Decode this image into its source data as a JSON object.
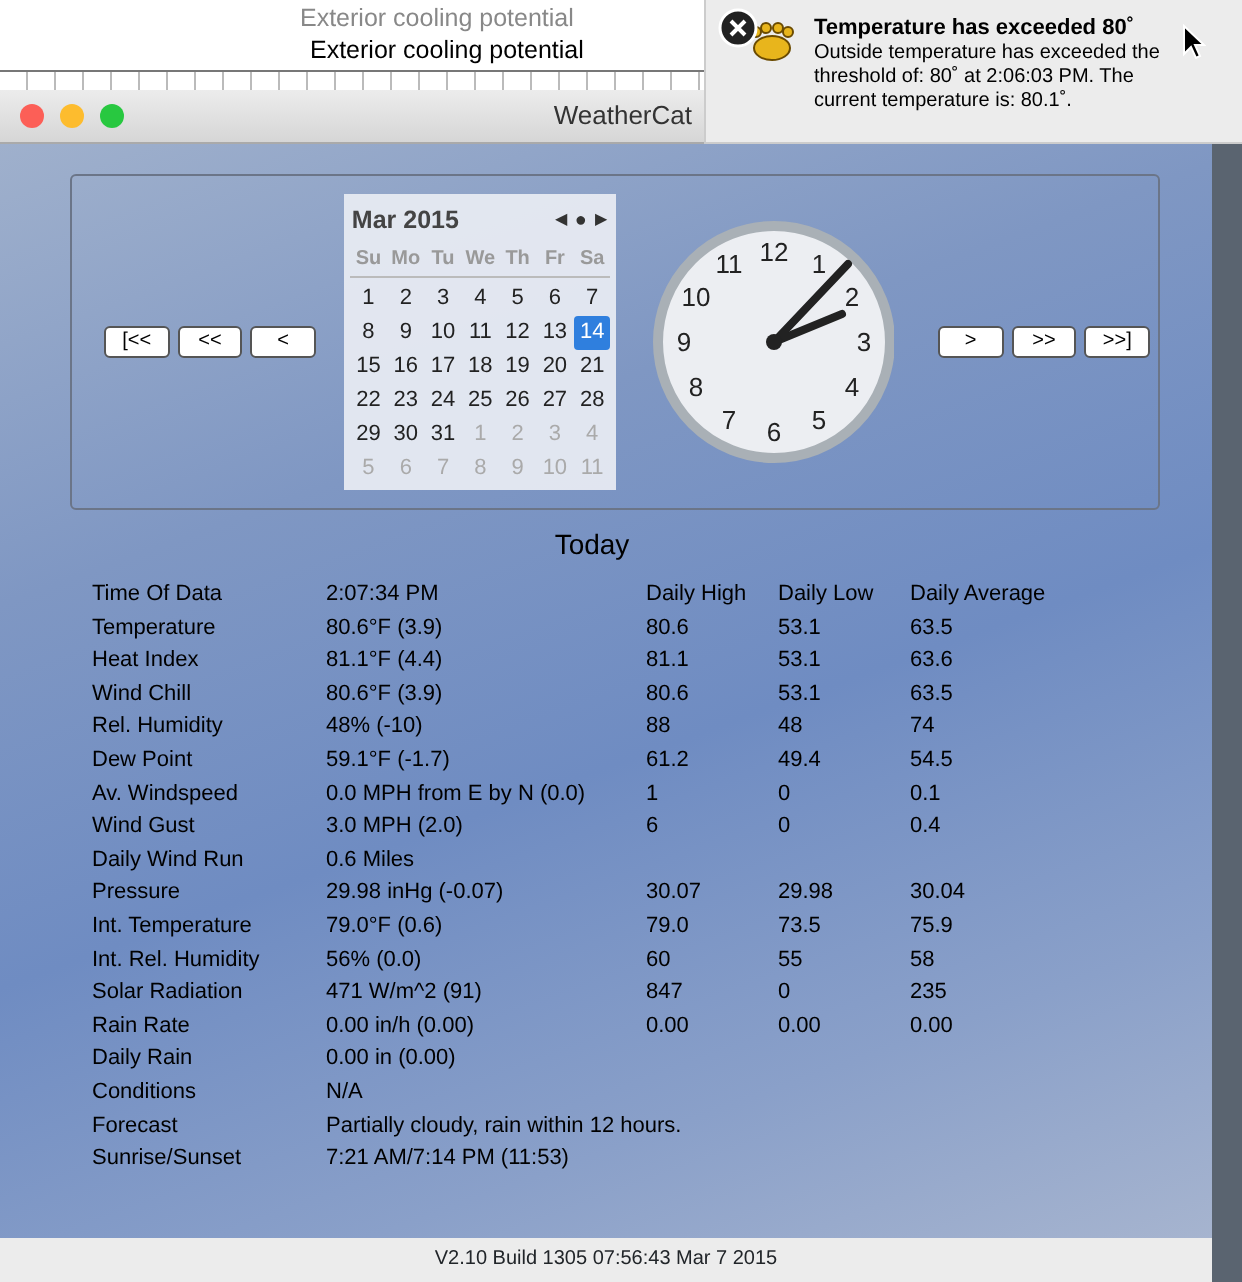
{
  "background_window": {
    "lines": [
      "Exterior cooling potential",
      "Exterior cooling potential"
    ]
  },
  "notification": {
    "title": "Temperature has exceeded 80˚",
    "body": "Outside temperature has exceeded the threshold of: 80˚ at 2:06:03 PM. The current temperature is: 80.1˚."
  },
  "window": {
    "title": "WeatherCat"
  },
  "nav_buttons_left": [
    "[<<",
    "<<",
    "<"
  ],
  "calendar": {
    "month": "Mar 2015",
    "prev": "◀",
    "today": "●",
    "next": "▶",
    "weekdays": [
      "Su",
      "Mo",
      "Tu",
      "We",
      "Th",
      "Fr",
      "Sa"
    ],
    "weeks": [
      [
        {
          "day": "1",
          "outside": false,
          "selected": false
        },
        {
          "day": "2",
          "outside": false,
          "selected": false
        },
        {
          "day": "3",
          "outside": false,
          "selected": false
        },
        {
          "day": "4",
          "outside": false,
          "selected": false
        },
        {
          "day": "5",
          "outside": false,
          "selected": false
        },
        {
          "day": "6",
          "outside": false,
          "selected": false
        },
        {
          "day": "7",
          "outside": false,
          "selected": false
        }
      ],
      [
        {
          "day": "8",
          "outside": false,
          "selected": false
        },
        {
          "day": "9",
          "outside": false,
          "selected": false
        },
        {
          "day": "10",
          "outside": false,
          "selected": false
        },
        {
          "day": "11",
          "outside": false,
          "selected": false
        },
        {
          "day": "12",
          "outside": false,
          "selected": false
        },
        {
          "day": "13",
          "outside": false,
          "selected": false
        },
        {
          "day": "14",
          "outside": false,
          "selected": true
        }
      ],
      [
        {
          "day": "15",
          "outside": false,
          "selected": false
        },
        {
          "day": "16",
          "outside": false,
          "selected": false
        },
        {
          "day": "17",
          "outside": false,
          "selected": false
        },
        {
          "day": "18",
          "outside": false,
          "selected": false
        },
        {
          "day": "19",
          "outside": false,
          "selected": false
        },
        {
          "day": "20",
          "outside": false,
          "selected": false
        },
        {
          "day": "21",
          "outside": false,
          "selected": false
        }
      ],
      [
        {
          "day": "22",
          "outside": false,
          "selected": false
        },
        {
          "day": "23",
          "outside": false,
          "selected": false
        },
        {
          "day": "24",
          "outside": false,
          "selected": false
        },
        {
          "day": "25",
          "outside": false,
          "selected": false
        },
        {
          "day": "26",
          "outside": false,
          "selected": false
        },
        {
          "day": "27",
          "outside": false,
          "selected": false
        },
        {
          "day": "28",
          "outside": false,
          "selected": false
        }
      ],
      [
        {
          "day": "29",
          "outside": false,
          "selected": false
        },
        {
          "day": "30",
          "outside": false,
          "selected": false
        },
        {
          "day": "31",
          "outside": false,
          "selected": false
        },
        {
          "day": "1",
          "outside": true,
          "selected": false
        },
        {
          "day": "2",
          "outside": true,
          "selected": false
        },
        {
          "day": "3",
          "outside": true,
          "selected": false
        },
        {
          "day": "4",
          "outside": true,
          "selected": false
        }
      ],
      [
        {
          "day": "5",
          "outside": true,
          "selected": false
        },
        {
          "day": "6",
          "outside": true,
          "selected": false
        },
        {
          "day": "7",
          "outside": true,
          "selected": false
        },
        {
          "day": "8",
          "outside": true,
          "selected": false
        },
        {
          "day": "9",
          "outside": true,
          "selected": false
        },
        {
          "day": "10",
          "outside": true,
          "selected": false
        },
        {
          "day": "11",
          "outside": true,
          "selected": false
        }
      ]
    ]
  },
  "clock": {
    "numbers": [
      "12",
      "11",
      "1",
      "10",
      "2",
      "9",
      "3",
      "8",
      "4",
      "7",
      "5",
      "6"
    ]
  },
  "nav_buttons_right": [
    ">",
    ">>",
    ">>]"
  ],
  "heading": "Today",
  "readings": {
    "header": [
      "Time Of Data",
      "2:07:34 PM",
      "Daily High",
      "Daily Low",
      "Daily Average"
    ],
    "rows": [
      [
        "Temperature",
        "80.6°F (3.9)",
        "80.6",
        "53.1",
        "63.5"
      ],
      [
        "Heat Index",
        "81.1°F (4.4)",
        "81.1",
        "53.1",
        "63.6"
      ],
      [
        "Wind Chill",
        "80.6°F (3.9)",
        "80.6",
        "53.1",
        "63.5"
      ],
      [
        "Rel. Humidity",
        "48% (-10)",
        "88",
        "48",
        "74"
      ],
      [
        "Dew Point",
        "59.1°F (-1.7)",
        "61.2",
        "49.4",
        "54.5"
      ],
      [
        "Av. Windspeed",
        "0.0 MPH from E by N (0.0)",
        "1",
        "0",
        "0.1"
      ],
      [
        "Wind Gust",
        "3.0 MPH  (2.0)",
        "6",
        "0",
        "0.4"
      ],
      [
        "Daily Wind Run",
        "0.6 Miles"
      ],
      [
        "Pressure",
        "29.98 inHg (-0.07)",
        "30.07",
        "29.98",
        "30.04"
      ],
      [
        "Int. Temperature",
        "79.0°F (0.6)",
        "79.0",
        "73.5",
        "75.9"
      ],
      [
        "Int. Rel. Humidity",
        "56% (0.0)",
        "60",
        "55",
        "58"
      ],
      [
        "Solar Radiation",
        "471 W/m^2  (91)",
        "847",
        "0",
        "235"
      ],
      [
        "Rain Rate",
        "0.00 in/h (0.00)",
        "0.00",
        "0.00",
        "0.00"
      ],
      [
        "Daily Rain",
        "0.00 in (0.00)"
      ],
      [
        "Conditions",
        "N/A"
      ],
      [
        "Forecast",
        "Partially cloudy, rain within 12 hours."
      ],
      [
        "Sunrise/Sunset",
        "7:21 AM/7:14 PM (11:53)"
      ]
    ]
  },
  "status_bar": "V2.10   Build 1305 07:56:43 Mar  7 2015"
}
